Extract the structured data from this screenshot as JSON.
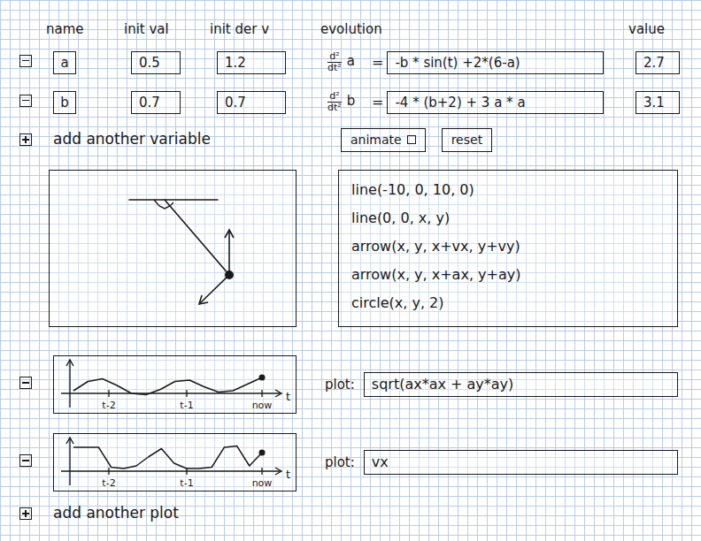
{
  "header": {
    "name": "name",
    "init_val": "init val",
    "init_der": "init der v",
    "evolution": "evolution",
    "value": "value"
  },
  "derivative": {
    "num": "d²",
    "den": "dt²",
    "equals": "="
  },
  "variables": [
    {
      "name": "a",
      "init_val": "0.5",
      "init_der": "1.2",
      "expression": "-b * sin(t) +2*(6-a)",
      "value": "2.7"
    },
    {
      "name": "b",
      "init_val": "0.7",
      "init_der": "0.7",
      "expression": "-4 * (b+2) + 3 a * a",
      "value": "3.1"
    }
  ],
  "add_variable": "add another variable",
  "animate": {
    "label": "animate",
    "checked": false
  },
  "reset": "reset",
  "script": [
    "line(-10, 0, 10, 0)",
    "line(0, 0, x, y)",
    "arrow(x, y, x+vx, y+vy)",
    "arrow(x, y, x+ax, y+ay)",
    "circle(x, y, 2)"
  ],
  "plots": [
    {
      "label": "plot:",
      "expression": "sqrt(ax*ax + ay*ay)",
      "ticks": [
        "t-2",
        "t-1",
        "now"
      ],
      "axis": "t",
      "values": [
        0.1,
        0.45,
        0.55,
        0.3,
        0.0,
        -0.05,
        0.15,
        0.45,
        0.5,
        0.25,
        0.05,
        0.1,
        0.35,
        0.6
      ]
    },
    {
      "label": "plot:",
      "expression": "vx",
      "ticks": [
        "t-2",
        "t-1",
        "now"
      ],
      "axis": "t",
      "values": [
        0.9,
        0.9,
        0.9,
        0.15,
        0.1,
        0.2,
        0.55,
        0.85,
        0.3,
        0.1,
        0.1,
        0.15,
        0.9,
        0.95,
        0.2,
        0.7
      ]
    }
  ],
  "add_plot": "add another plot"
}
